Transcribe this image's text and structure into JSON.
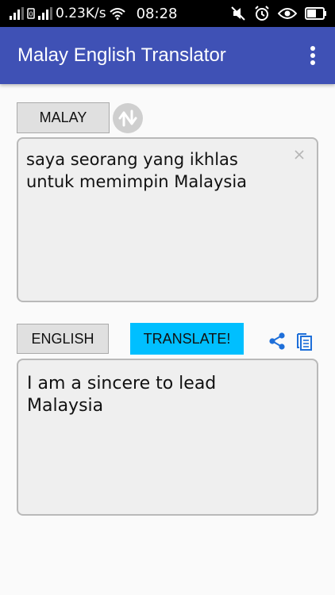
{
  "status_bar": {
    "network_speed": "0.23K/s",
    "time": "08:28",
    "icons": [
      "signal-icon",
      "sim-icon",
      "signal-icon",
      "wifi-icon",
      "mute-icon",
      "alarm-icon",
      "eye-icon",
      "battery-icon"
    ]
  },
  "app_bar": {
    "title": "Malay English Translator",
    "menu_icon": "more-vert-icon"
  },
  "source": {
    "language_label": "MALAY",
    "text": "saya seorang yang ikhlas\nuntuk memimpin Malaysia",
    "clear_icon": "close-icon"
  },
  "swap_icon": "swap-vertical-icon",
  "target": {
    "language_label": "ENGLISH",
    "translate_label": "TRANSLATE!",
    "share_icon": "share-icon",
    "copy_icon": "copy-icon",
    "text": "I am a sincere to lead Malaysia"
  },
  "colors": {
    "app_bar": "#3f51b5",
    "translate_button": "#00bfff",
    "action_icons": "#1e6fd9"
  }
}
